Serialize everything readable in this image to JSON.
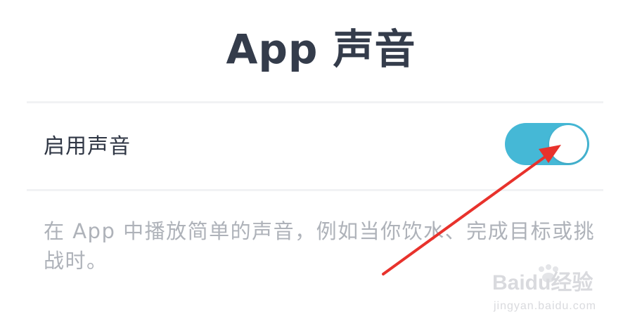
{
  "header": {
    "title": "App 声音"
  },
  "setting": {
    "label": "启用声音",
    "toggle_state": "on",
    "toggle_color": "#45b8d6"
  },
  "description": "在 App 中播放简单的声音，例如当你饮水、完成目标或挑战时。",
  "annotation": {
    "arrow_color": "#e8322c"
  },
  "watermark": {
    "logo": "Baidu经验",
    "url": "jingyan.baidu.com"
  }
}
